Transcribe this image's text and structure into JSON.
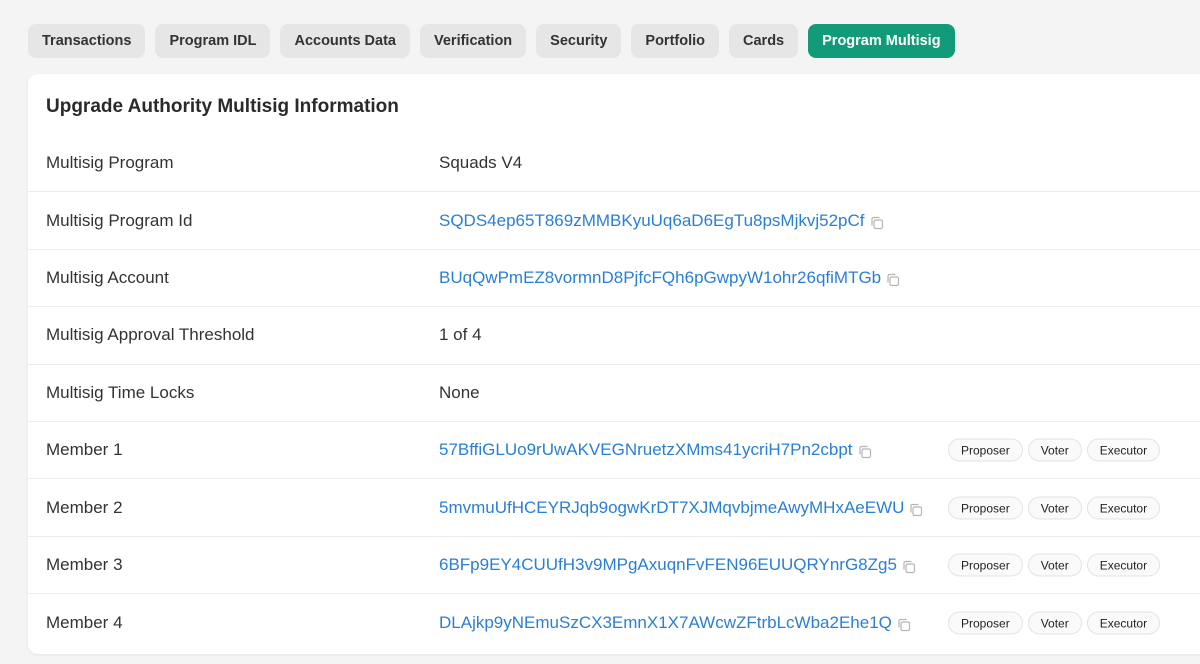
{
  "tabs": [
    {
      "label": "Transactions",
      "active": false
    },
    {
      "label": "Program IDL",
      "active": false
    },
    {
      "label": "Accounts Data",
      "active": false
    },
    {
      "label": "Verification",
      "active": false
    },
    {
      "label": "Security",
      "active": false
    },
    {
      "label": "Portfolio",
      "active": false
    },
    {
      "label": "Cards",
      "active": false
    },
    {
      "label": "Program Multisig",
      "active": true
    }
  ],
  "card": {
    "title": "Upgrade Authority Multisig Information",
    "rows": [
      {
        "label": "Multisig Program",
        "value": "Squads V4"
      },
      {
        "label": "Multisig Program Id",
        "value": "SQDS4ep65T869zMMBKyuUq6aD6EgTu8psMjkvj52pCf"
      },
      {
        "label": "Multisig Account",
        "value": "BUqQwPmEZ8vormnD8PjfcFQh6pGwpyW1ohr26qfiMTGb"
      },
      {
        "label": "Multisig Approval Threshold",
        "value": "1 of 4"
      },
      {
        "label": "Multisig Time Locks",
        "value": "None"
      },
      {
        "label": "Member 1",
        "value": "57BffiGLUo9rUwAKVEGNruetzXMms41ycriH7Pn2cbpt"
      },
      {
        "label": "Member 2",
        "value": "5mvmuUfHCEYRJqb9ogwKrDT7XJMqvbjmeAwyMHxAeEWU"
      },
      {
        "label": "Member 3",
        "value": "6BFp9EY4CUUfH3v9MPgAxuqnFvFEN96EUUQRYnrG8Zg5"
      },
      {
        "label": "Member 4",
        "value": "DLAjkp9yNEmuSzCX3EmnX1X7AWcwZFtrbLcWba2Ehe1Q"
      }
    ],
    "roles": [
      "Proposer",
      "Voter",
      "Executor"
    ]
  },
  "colors": {
    "accent": "#129b79",
    "link": "#2a7fd4"
  },
  "icons": {
    "copy": "copy-icon"
  }
}
